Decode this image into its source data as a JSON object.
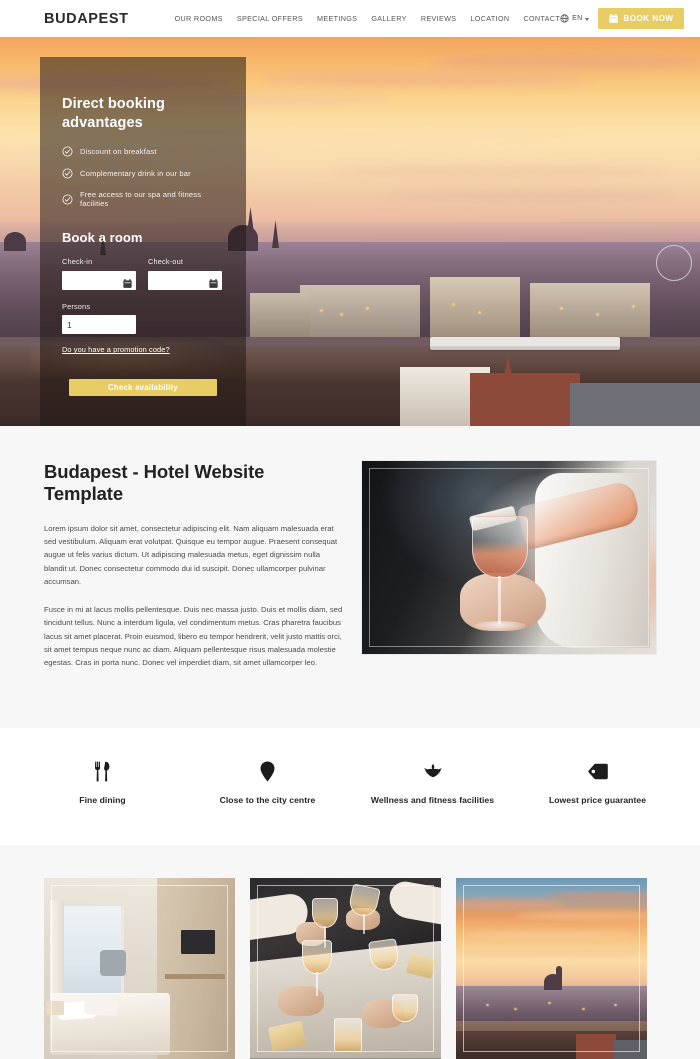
{
  "header": {
    "logo": "BUDAPEST",
    "nav": [
      {
        "label": "OUR ROOMS"
      },
      {
        "label": "SPECIAL OFFERS"
      },
      {
        "label": "MEETINGS"
      },
      {
        "label": "GALLERY"
      },
      {
        "label": "REVIEWS"
      },
      {
        "label": "LOCATION"
      },
      {
        "label": "CONTACT"
      }
    ],
    "language": {
      "icon": "globe-icon",
      "label": "EN",
      "caret": "chevron-down-icon"
    },
    "book_now": {
      "label": "BOOK NOW",
      "icon": "calendar-icon",
      "color": "#e8cd64"
    }
  },
  "hero": {
    "panel": {
      "title": "Direct booking advantages",
      "advantages": [
        {
          "icon": "check-circle-icon",
          "text": "Discount on breakfast"
        },
        {
          "icon": "check-circle-icon",
          "text": "Complementary drink in our bar"
        },
        {
          "icon": "check-circle-icon",
          "text": "Free access to our spa and fitness facilities"
        }
      ],
      "form": {
        "heading": "Book a room",
        "checkin": {
          "label": "Check-in",
          "value": "",
          "placeholder": "",
          "icon": "calendar-icon"
        },
        "checkout": {
          "label": "Check-out",
          "value": "",
          "placeholder": "",
          "icon": "calendar-icon"
        },
        "persons": {
          "label": "Persons",
          "value": "1"
        },
        "promo_link": "Do you have a promotion code?",
        "submit": {
          "label": "Check availability",
          "color": "#e8cd64"
        }
      }
    }
  },
  "about": {
    "title": "Budapest - Hotel Website Template",
    "paragraphs": [
      "Lorem ipsum dolor sit amet, consectetur adipiscing elit. Nam aliquam malesuada erat sed vestibulum. Aliquam erat volutpat. Quisque eu tempor augue. Praesent consequat augue ut felis varius dictum. Ut adipiscing malesuada metus, eget dignissim nulla blandit ut. Donec consectetur commodo dui id suscipit. Donec ullamcorper pulvinar accumsan.",
      "Fusce in mi at lacus mollis pellentesque. Duis nec massa justo. Duis et mollis diam, sed tincidunt tellus. Nunc a interdum ligula, vel condimentum metus. Cras pharetra faucibus lacus sit amet placerat. Proin euismod, libero eu tempor hendrerit, velit justo mattis orci, sit amet tempus neque nunc ac diam. Aliquam pellentesque risus malesuada molestie egestas. Cras in porta nunc. Donec vel imperdiet diam, sit amet ullamcorper leo."
    ],
    "image_alt": "waiter pouring rose wine into a glass"
  },
  "features": [
    {
      "icon": "cutlery-icon",
      "label": "Fine dining"
    },
    {
      "icon": "map-pin-icon",
      "label": "Close to the city centre"
    },
    {
      "icon": "spa-lotus-icon",
      "label": "Wellness and fitness facilities"
    },
    {
      "icon": "price-tag-icon",
      "label": "Lowest price guarantee"
    }
  ],
  "gallery": [
    {
      "name": "hotel-room",
      "alt": "modern hotel room with large window and bed"
    },
    {
      "name": "dining-toast",
      "alt": "people toasting with wine glasses at a dinner table"
    },
    {
      "name": "city-sunset",
      "alt": "Budapest skyline at sunset over the Danube"
    }
  ],
  "colors": {
    "accent": "#e8cd64",
    "text_dark": "#222222",
    "body_text": "#4c4c4c",
    "section_bg": "#f7f7f7",
    "overlay": "rgba(34,24,20,0.55)"
  }
}
